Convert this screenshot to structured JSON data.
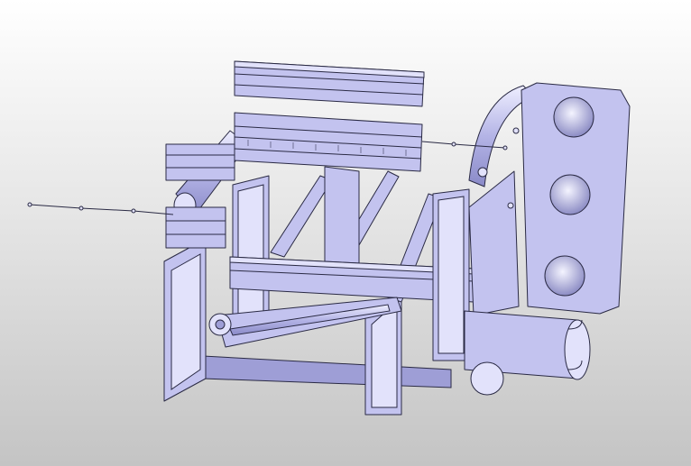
{
  "viewer": {
    "colors": {
      "background_top": "#ffffff",
      "background_bottom": "#c4c4c4",
      "part_fill": "#c3c3ef",
      "part_shadow": "#9e9ed6",
      "edge": "#2a2a44"
    },
    "model": {
      "components": [
        "top-rail",
        "upper-slotted-rail",
        "rear-tube",
        "left-side-frame",
        "center-post",
        "crossbeam",
        "right-side-frame",
        "end-plate",
        "pivot-arm",
        "bottom-drum",
        "control-wire"
      ]
    }
  }
}
